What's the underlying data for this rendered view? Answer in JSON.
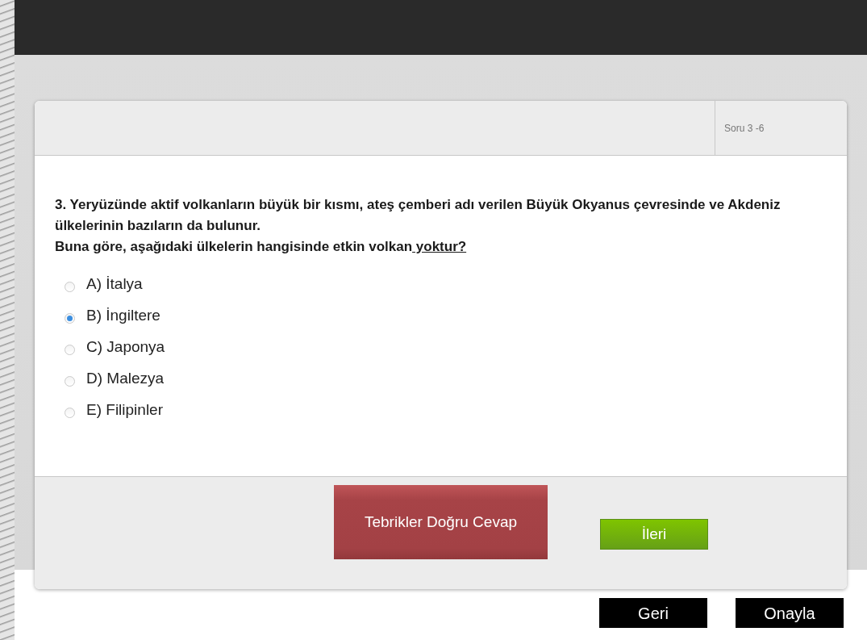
{
  "header": {
    "counter": "Soru 3 -6"
  },
  "question": {
    "text": "3. Yeryüzünde aktif volkanların büyük bir kısmı, ateş çemberi adı verilen Büyük Okyanus çevresinde ve Akdeniz ülkelerinin bazıların da bulunur.",
    "prompt": "Buna göre, aşağıdaki ülkelerin hangisinde etkin volkan",
    "prompt_underlined": " yoktur?"
  },
  "options": [
    {
      "label": "A) İtalya",
      "selected": false
    },
    {
      "label": "B) İngiltere",
      "selected": true
    },
    {
      "label": "C) Japonya",
      "selected": false
    },
    {
      "label": "D) Malezya",
      "selected": false
    },
    {
      "label": "E) Filipinler",
      "selected": false
    }
  ],
  "feedback": {
    "text": "Tebrikler Doğru Cevap"
  },
  "next_button": "İleri",
  "nav_buttons": [
    "Geri",
    "Onayla"
  ]
}
